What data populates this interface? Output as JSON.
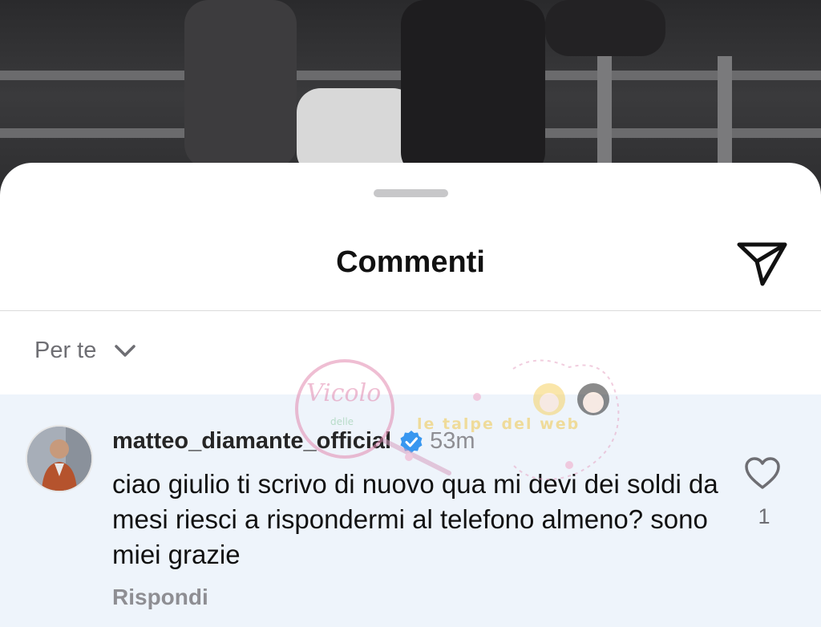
{
  "sheet": {
    "title": "Commenti"
  },
  "filter": {
    "label": "Per te"
  },
  "comment": {
    "username": "matteo_diamante_official",
    "time": "53m",
    "text": "ciao giulio ti scrivo di nuovo qua mi devi dei soldi da mesi riesci a rispondermi al telefono almeno? sono miei grazie",
    "reply_label": "Rispondi",
    "like_count": "1"
  },
  "watermark": {
    "line1": "Vicolo",
    "line2": "delle",
    "line3": "le talpe del web"
  },
  "icons": {
    "send": "paper-plane-icon",
    "chevron": "chevron-down-icon",
    "verified": "verified-badge-icon",
    "like": "heart-outline-icon"
  },
  "colors": {
    "verified": "#3897f0",
    "comment_bg": "#eef4fb",
    "muted": "#8e8e93"
  }
}
